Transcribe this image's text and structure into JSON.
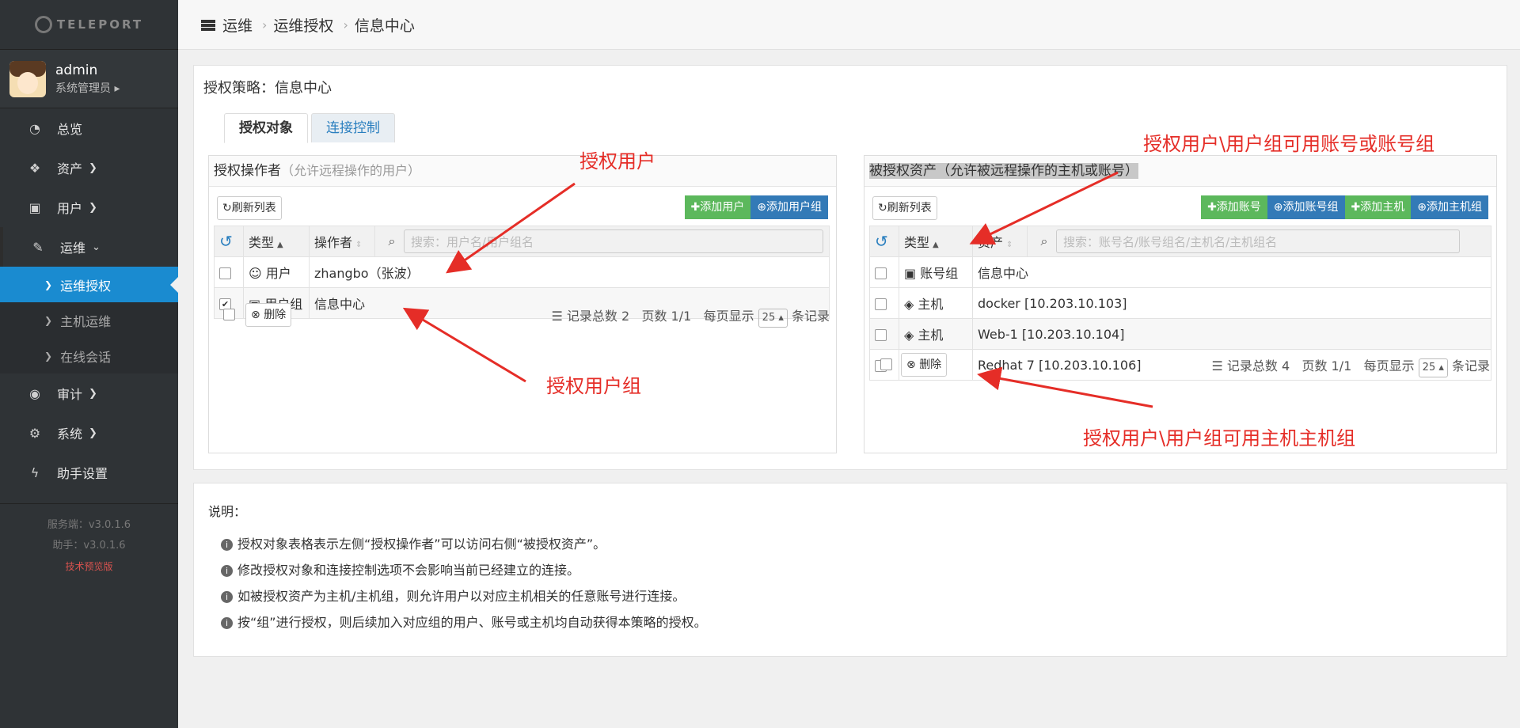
{
  "app": {
    "logo_text": "TELEPORT"
  },
  "user": {
    "name": "admin",
    "role": "系统管理员"
  },
  "nav": {
    "overview": "总览",
    "assets": "资产",
    "users": "用户",
    "ops": "运维",
    "ops_sub": [
      "运维授权",
      "主机运维",
      "在线会话"
    ],
    "audit": "审计",
    "system": "系统",
    "assistant": "助手设置"
  },
  "versions": {
    "server": "服务端：v3.0.1.6",
    "assistant": "助手：v3.0.1.6",
    "preview": "技术预览版"
  },
  "breadcrumb": [
    "运维",
    "运维授权",
    "信息中心"
  ],
  "policy_title": "授权策略：信息中心",
  "tabs": [
    "授权对象",
    "连接控制"
  ],
  "operators": {
    "title": "授权操作者",
    "hint": "（允许远程操作的用户）",
    "refresh": "刷新列表",
    "add_user": "添加用户",
    "add_user_group": "添加用户组",
    "col_type": "类型",
    "col_operator": "操作者",
    "search_placeholder": "搜索：用户名/用户组名",
    "rows": [
      {
        "type": "用户",
        "name": "zhangbo（张波）",
        "checked": false
      },
      {
        "type": "用户组",
        "name": "信息中心",
        "checked": true
      }
    ],
    "delete": "删除",
    "pager": {
      "total": "记录总数 2",
      "pages": "页数 1/1",
      "per_page_label": "每页显示",
      "per_page": "25",
      "suffix": "条记录"
    }
  },
  "assets": {
    "title": "被授权资产",
    "hint": "（允许被远程操作的主机或账号）",
    "refresh": "刷新列表",
    "add_account": "添加账号",
    "add_account_group": "添加账号组",
    "add_host": "添加主机",
    "add_host_group": "添加主机组",
    "col_type": "类型",
    "col_asset": "资产",
    "search_placeholder": "搜索：账号名/账号组名/主机名/主机组名",
    "rows": [
      {
        "type": "账号组",
        "name": "信息中心"
      },
      {
        "type": "主机",
        "name": "docker [10.203.10.103]"
      },
      {
        "type": "主机",
        "name": "Web-1 [10.203.10.104]"
      },
      {
        "type": "主机",
        "name": "Redhat 7 [10.203.10.106]"
      }
    ],
    "delete": "删除",
    "pager": {
      "total": "记录总数 4",
      "pages": "页数 1/1",
      "per_page_label": "每页显示",
      "per_page": "25",
      "suffix": "条记录"
    }
  },
  "annotations": {
    "auth_user": "授权用户",
    "auth_user_group": "授权用户组",
    "account_note": "授权用户\\用户组可用账号或账号组",
    "host_note": "授权用户\\用户组可用主机主机组"
  },
  "notes": {
    "title": "说明：",
    "items": [
      "授权对象表格表示左侧“授权操作者”可以访问右侧“被授权资产”。",
      "修改授权对象和连接控制选项不会影响当前已经建立的连接。",
      "如被授权资产为主机/主机组，则允许用户以对应主机相关的任意账号进行连接。",
      "按“组”进行授权，则后续加入对应组的用户、账号或主机均自动获得本策略的授权。"
    ]
  },
  "colors": {
    "accent": "#1a8bd0",
    "green": "#5cb85c",
    "blue": "#337ab7",
    "annotation": "#e52d27"
  }
}
